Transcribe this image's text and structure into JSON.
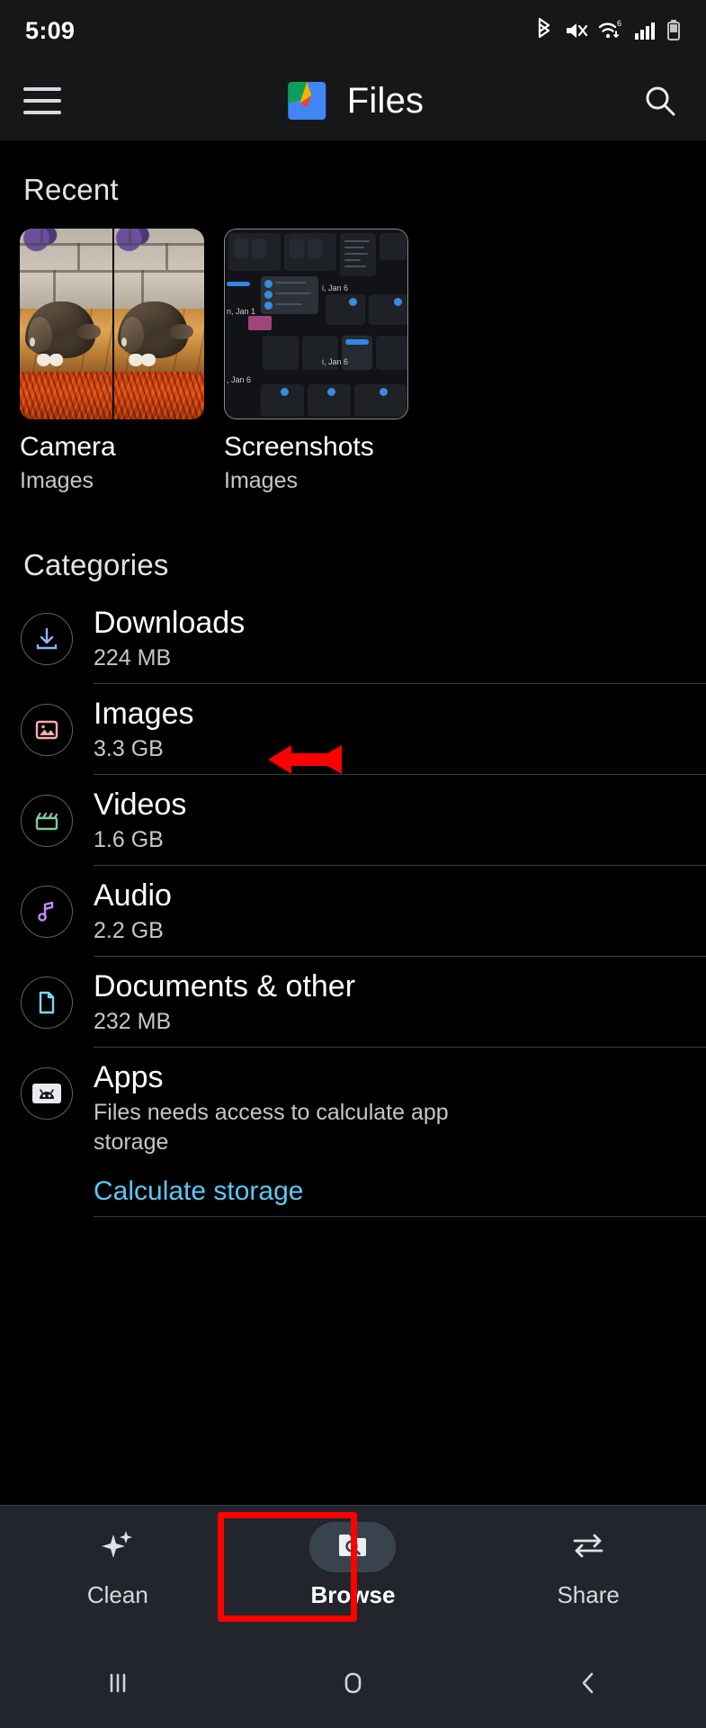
{
  "status_bar": {
    "time": "5:09",
    "icons": [
      "bluetooth-icon",
      "volume-mute-icon",
      "wifi-6-icon",
      "cellular-signal-icon",
      "battery-icon"
    ]
  },
  "app_bar": {
    "menu_icon": "hamburger-menu-icon",
    "logo_icon": "files-app-logo",
    "title": "Files",
    "search_icon": "search-icon"
  },
  "recent": {
    "heading": "Recent",
    "items": [
      {
        "name": "Camera",
        "subtitle": "Images",
        "thumb": "cat-photo-thumbnail"
      },
      {
        "name": "Screenshots",
        "subtitle": "Images",
        "thumb": "screenshots-collage-thumbnail"
      }
    ]
  },
  "categories": {
    "heading": "Categories",
    "items": [
      {
        "label": "Downloads",
        "size": "224 MB",
        "icon": "download-icon",
        "color": "#8ab4f8"
      },
      {
        "label": "Images",
        "size": "3.3 GB",
        "icon": "image-icon",
        "color": "#f6aea9"
      },
      {
        "label": "Videos",
        "size": "1.6 GB",
        "icon": "movie-clapper-icon",
        "color": "#81c995"
      },
      {
        "label": "Audio",
        "size": "2.2 GB",
        "icon": "music-note-icon",
        "color": "#c58af9"
      },
      {
        "label": "Documents & other",
        "size": "232 MB",
        "icon": "document-icon",
        "color": "#78d9ec"
      },
      {
        "label": "Apps",
        "size": "",
        "description": "Files needs access to calculate app storage",
        "icon": "android-app-icon",
        "color": "#ffffff",
        "action_label": "Calculate storage"
      }
    ]
  },
  "annotations": {
    "arrow_target": "Downloads",
    "box_target": "Browse",
    "color": "#fe0000"
  },
  "bottom_nav": {
    "items": [
      {
        "label": "Clean",
        "icon": "sparkle-icon",
        "active": false
      },
      {
        "label": "Browse",
        "icon": "folder-search-icon",
        "active": true
      },
      {
        "label": "Share",
        "icon": "swap-arrows-icon",
        "active": false
      }
    ]
  },
  "system_nav": {
    "items": [
      {
        "name": "recents-button",
        "icon": "recents-icon"
      },
      {
        "name": "home-button",
        "icon": "home-icon"
      },
      {
        "name": "back-button",
        "icon": "back-chevron-icon"
      }
    ]
  },
  "colors": {
    "background": "#000000",
    "chrome": "#161719",
    "bottom_nav_bg": "#22262c",
    "link": "#5cc8f5",
    "annotation": "#fe0000"
  }
}
